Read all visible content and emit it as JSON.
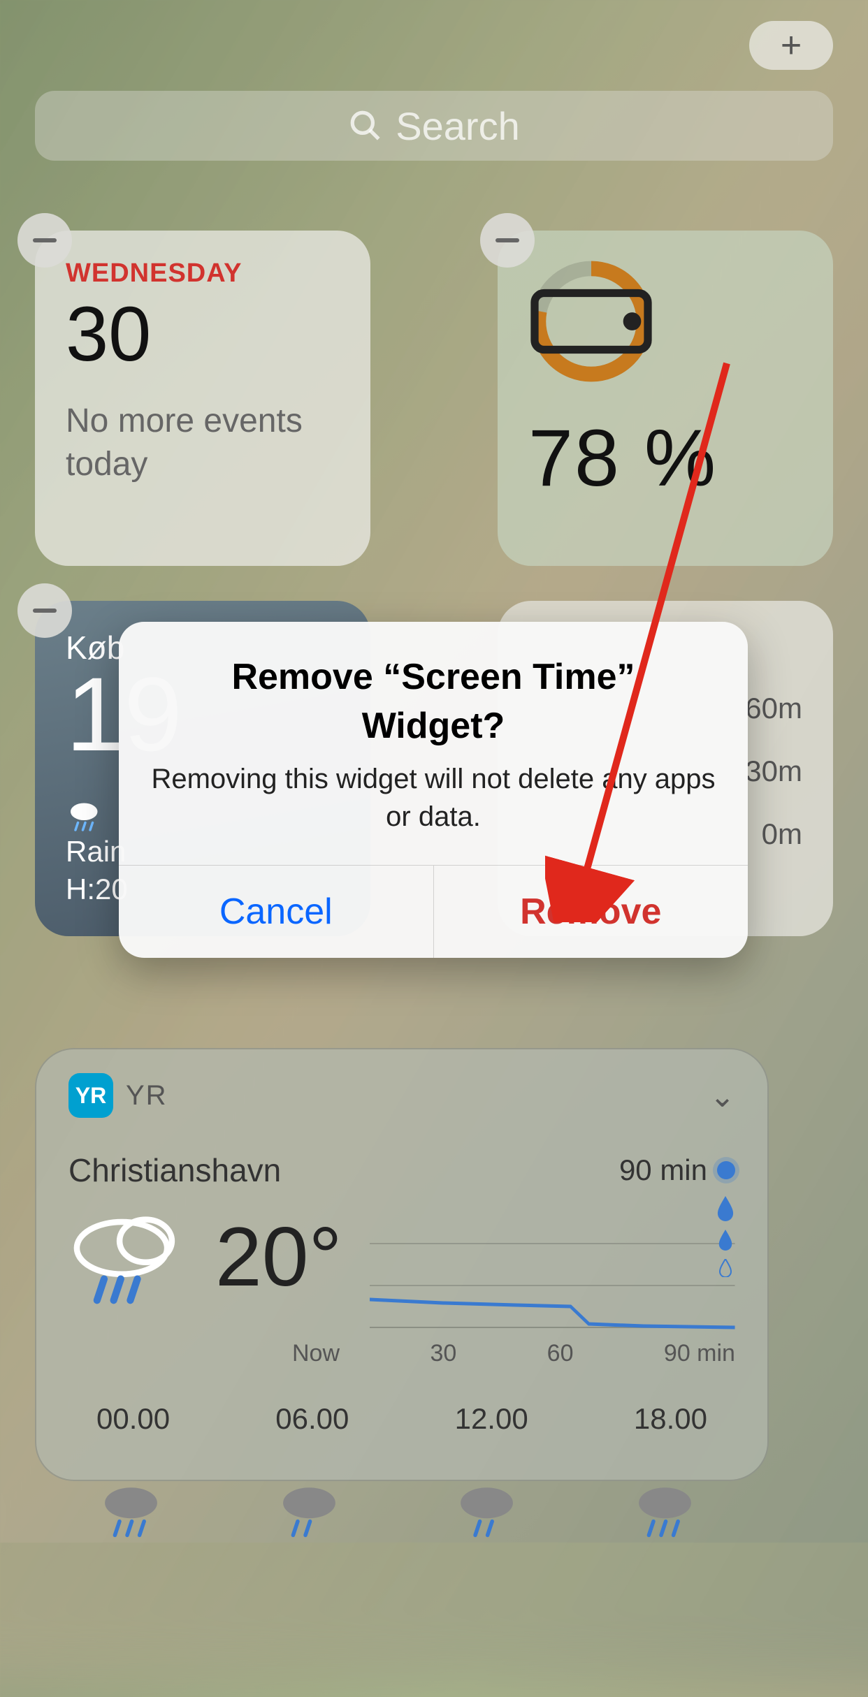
{
  "add_button": "+",
  "search": {
    "placeholder": "Search"
  },
  "calendar": {
    "day": "WEDNESDAY",
    "date": "30",
    "message": "No more events today"
  },
  "screentime": {
    "percent": "78 %"
  },
  "weather": {
    "city": "Køb",
    "temp": "19",
    "cond": "Rain",
    "hilo": "H:20"
  },
  "unknown_widget": {
    "rows": [
      "60m",
      "30m",
      "0m"
    ]
  },
  "yr": {
    "app_label": "YR",
    "location": "Christianshavn",
    "duration": "90 min",
    "temp": "20°",
    "axis": [
      "Now",
      "30",
      "60",
      "90 min"
    ],
    "times": [
      "00.00",
      "06.00",
      "12.00",
      "18.00"
    ]
  },
  "modal": {
    "title": "Remove “Screen Time” Widget?",
    "message": "Removing this widget will not delete any apps or data.",
    "cancel": "Cancel",
    "remove": "Remove"
  }
}
